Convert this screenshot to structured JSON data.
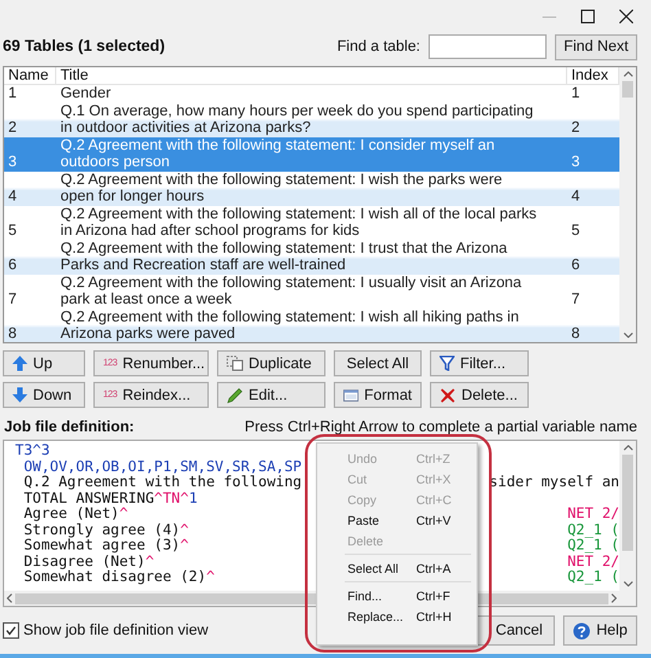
{
  "header": {
    "count_label": "69 Tables  (1 selected)",
    "find_label": "Find a table:",
    "find_button": "Find Next"
  },
  "table": {
    "columns": [
      "Name",
      "Title",
      "Index"
    ],
    "rows": [
      {
        "name": "1",
        "title": "Gender",
        "index": "1",
        "selected": false
      },
      {
        "name": "2",
        "title": "Q.1 On average, how many hours per week do you spend participating in outdoor activities at Arizona parks?",
        "index": "2",
        "selected": false
      },
      {
        "name": "3",
        "title": "Q.2 Agreement with the following statement: I consider myself an outdoors person",
        "index": "3",
        "selected": true
      },
      {
        "name": "4",
        "title": "Q.2 Agreement with the following statement: I wish the parks were open for longer hours",
        "index": "4",
        "selected": false
      },
      {
        "name": "5",
        "title": "Q.2 Agreement with the following statement: I wish all of the local parks in Arizona had after school programs for kids",
        "index": "5",
        "selected": false
      },
      {
        "name": "6",
        "title": "Q.2 Agreement with the following statement: I trust that the Arizona Parks and Recreation staff are well-trained",
        "index": "6",
        "selected": false
      },
      {
        "name": "7",
        "title": "Q.2 Agreement with the following statement: I usually visit an Arizona park at least once a week",
        "index": "7",
        "selected": false
      },
      {
        "name": "8",
        "title": "Q.2 Agreement with the following statement: I wish all hiking paths in Arizona parks were paved",
        "index": "8",
        "selected": false
      }
    ]
  },
  "buttons": [
    [
      {
        "label": "Up"
      },
      {
        "label": "Renumber...",
        "icon_text": "123"
      },
      {
        "label": "Duplicate"
      },
      {
        "label": "Select All"
      },
      {
        "label": "Filter..."
      }
    ],
    [
      {
        "label": "Down"
      },
      {
        "label": "Reindex...",
        "icon_text": "123"
      },
      {
        "label": "Edit..."
      },
      {
        "label": "Format"
      },
      {
        "label": "Delete..."
      }
    ]
  ],
  "editor": {
    "label": "Job file definition:",
    "hint": "Press Ctrl+Right Arrow to complete a partial variable name",
    "lines": [
      {
        "left": [
          {
            "text": "T3^3",
            "kind": "command"
          }
        ]
      },
      {
        "left": [
          {
            "text": " OW,OV,OR,OB,OI,P1,SM,SV,SR,SA,SP",
            "kind": "command"
          }
        ]
      },
      {
        "left": [
          {
            "text": " Q.2 Agreement with the following",
            "kind": "plain"
          }
        ],
        "right": [
          {
            "text": "sider myself an",
            "kind": "plain"
          }
        ]
      },
      {
        "left": [
          {
            "text": " TOTAL ANSWERING",
            "kind": "plain"
          },
          {
            "text": "^TN^",
            "kind": "caret"
          },
          {
            "text": "1",
            "kind": "command"
          }
        ]
      },
      {
        "left": [
          {
            "text": " Agree (Net)",
            "kind": "plain"
          },
          {
            "text": "^",
            "kind": "caret"
          }
        ],
        "right": [
          {
            "text": "NET 2/",
            "kind": "caret"
          }
        ]
      },
      {
        "left": [
          {
            "text": " Strongly agree (4)",
            "kind": "plain"
          },
          {
            "text": "^",
            "kind": "caret"
          }
        ],
        "right": [
          {
            "text": "Q2_1 (",
            "kind": "variable"
          }
        ]
      },
      {
        "left": [
          {
            "text": " Somewhat agree (3)",
            "kind": "plain"
          },
          {
            "text": "^",
            "kind": "caret"
          }
        ],
        "right": [
          {
            "text": "Q2_1 (",
            "kind": "variable"
          }
        ]
      },
      {
        "left": [
          {
            "text": " Disagree (Net)",
            "kind": "plain"
          },
          {
            "text": "^",
            "kind": "caret"
          }
        ],
        "right": [
          {
            "text": "NET 2/",
            "kind": "caret"
          }
        ]
      },
      {
        "left": [
          {
            "text": " Somewhat disagree (2)",
            "kind": "plain"
          },
          {
            "text": "^",
            "kind": "caret"
          }
        ],
        "right": [
          {
            "text": "Q2_1 (",
            "kind": "variable"
          }
        ]
      }
    ]
  },
  "show_view": {
    "label": "Show job file definition view",
    "checked": true
  },
  "footer_buttons": [
    {
      "label": "Cancel"
    },
    {
      "label": "Help"
    }
  ],
  "context_menu": {
    "groups": [
      [
        {
          "label": "Undo",
          "shortcut": "Ctrl+Z",
          "disabled": true
        },
        {
          "label": "Cut",
          "shortcut": "Ctrl+X",
          "disabled": true
        },
        {
          "label": "Copy",
          "shortcut": "Ctrl+C",
          "disabled": true
        },
        {
          "label": "Paste",
          "shortcut": "Ctrl+V",
          "disabled": false
        },
        {
          "label": "Delete",
          "disabled": true
        }
      ],
      [
        {
          "label": "Select All",
          "shortcut": "Ctrl+A",
          "disabled": false
        }
      ],
      [
        {
          "label": "Find...",
          "shortcut": "Ctrl+F",
          "disabled": false
        },
        {
          "label": "Replace...",
          "shortcut": "Ctrl+H",
          "disabled": false
        }
      ]
    ]
  }
}
